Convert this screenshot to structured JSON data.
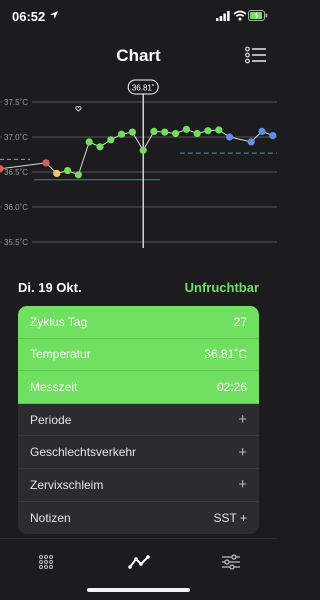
{
  "status_bar": {
    "time": "06:52",
    "icons": [
      "location-arrow-icon",
      "signal-icon",
      "wifi-icon",
      "battery-charging-icon"
    ]
  },
  "header": {
    "title": "Chart",
    "menu_icon": "list-menu-icon"
  },
  "chart_data": {
    "type": "line",
    "y_tick_labels": [
      "37.5˚C",
      "37.0˚C",
      "36.5˚C",
      "36.0˚C",
      "35.5˚C"
    ],
    "y_ticks": [
      37.5,
      37.0,
      36.5,
      36.0,
      35.5
    ],
    "ylim": [
      35.5,
      37.5
    ],
    "selected_value_label": "36.81˚",
    "selected_day": 27,
    "points": [
      {
        "day": 8,
        "temp": 36.63,
        "color": "#e05a5a"
      },
      {
        "day": 9,
        "temp": 36.48,
        "color": "#f2cc55"
      },
      {
        "day": 10,
        "temp": 36.52,
        "color": "#6ee05a"
      },
      {
        "day": 11,
        "temp": 36.46,
        "color": "#6ee05a"
      },
      {
        "day": 12,
        "temp": 36.93,
        "color": "#6ee05a"
      },
      {
        "day": 13,
        "temp": 36.86,
        "color": "#6ee05a"
      },
      {
        "day": 14,
        "temp": 36.96,
        "color": "#6ee05a"
      },
      {
        "day": 15,
        "temp": 37.04,
        "color": "#6ee05a"
      },
      {
        "day": 16,
        "temp": 37.07,
        "color": "#6ee05a"
      },
      {
        "day": 17,
        "temp": 36.81,
        "color": "#6ee05a"
      },
      {
        "day": 18,
        "temp": 37.08,
        "color": "#6ee05a"
      },
      {
        "day": 19,
        "temp": 37.07,
        "color": "#6ee05a"
      },
      {
        "day": 20,
        "temp": 37.05,
        "color": "#6ee05a"
      },
      {
        "day": 21,
        "temp": 37.11,
        "color": "#6ee05a"
      },
      {
        "day": 22,
        "temp": 37.05,
        "color": "#6ee05a"
      },
      {
        "day": 23,
        "temp": 37.09,
        "color": "#6ee05a"
      },
      {
        "day": 24,
        "temp": 37.1,
        "color": "#6ee05a"
      },
      {
        "day": 25,
        "temp": 37.0,
        "color": "#5f8fe8"
      },
      {
        "day": 27,
        "temp": 36.93,
        "color": "#5f8fe8"
      },
      {
        "day": 28,
        "temp": 37.08,
        "color": "#5f8fe8"
      },
      {
        "day": 29,
        "temp": 37.02,
        "color": "#5f8fe8"
      }
    ],
    "left_partial_points": [
      {
        "temp": 36.59,
        "color": "#e05a5a"
      }
    ],
    "coverline_low": 36.39,
    "coverline_dashed_right": 36.77,
    "coverline_dashed_left": 36.68,
    "heart_marker_day": 11,
    "colors": {
      "period": "#e05a5a",
      "transition": "#f2cc55",
      "fertile": "#6ee05a",
      "luteal": "#5f8fe8",
      "coverline": "#3f7fa8",
      "grid": "#6a6a6e",
      "line": "#d8d8d8"
    }
  },
  "day_row": {
    "date": "Di. 19 Okt.",
    "fertility": "Unfruchtbar"
  },
  "details": {
    "rows": [
      {
        "label": "Zyklus Tag",
        "value": "27"
      },
      {
        "label": "Temperatur",
        "value": "36.81˚C"
      },
      {
        "label": "Messzeit",
        "value": "02:26"
      },
      {
        "label": "Periode",
        "value": "+"
      },
      {
        "label": "Geschlechtsverkehr",
        "value": "+"
      },
      {
        "label": "Zervixschleim",
        "value": "+"
      },
      {
        "label": "Notizen",
        "value": "SST +"
      }
    ]
  },
  "tab_bar": {
    "tabs": [
      {
        "name": "grid-dots-icon"
      },
      {
        "name": "chart-line-icon"
      },
      {
        "name": "sliders-icon"
      }
    ]
  }
}
